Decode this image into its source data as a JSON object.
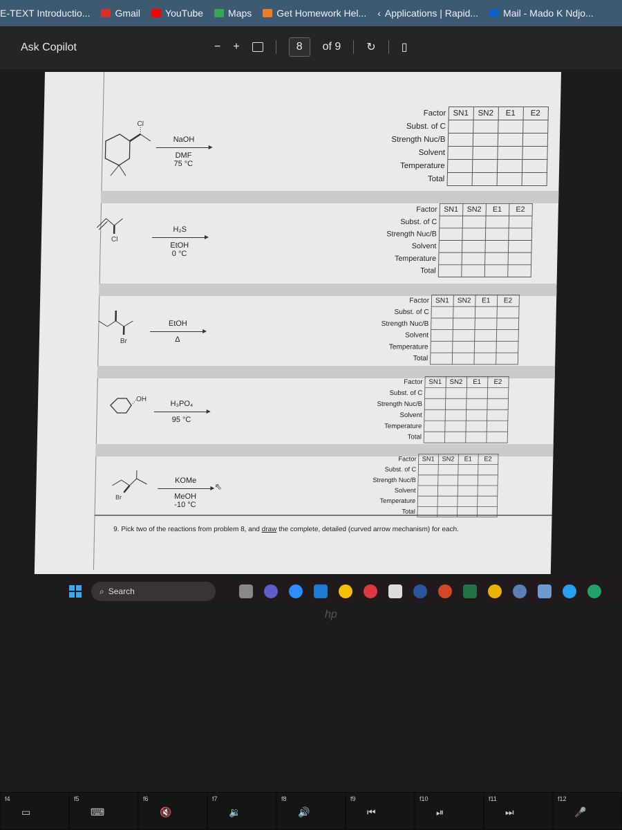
{
  "bookmarks": [
    {
      "label": "E-TEXT Introductio...",
      "color": "#3e5a70"
    },
    {
      "label": "Gmail",
      "color": "#d93025"
    },
    {
      "label": "YouTube",
      "color": "#ff0000"
    },
    {
      "label": "Maps",
      "color": "#34a853"
    },
    {
      "label": "Get Homework Hel...",
      "color": "#f07c25"
    },
    {
      "label": "Applications | Rapid...",
      "color": "#3e5a70"
    },
    {
      "label": "Mail - Mado K Ndjo...",
      "color": "#0a64c8"
    }
  ],
  "pdf_toolbar": {
    "copilot": "Ask Copilot",
    "zoom_out": "−",
    "zoom_in": "+",
    "page": "8",
    "page_total": "of 9"
  },
  "table": {
    "headers": [
      "Factor",
      "SN1",
      "SN2",
      "E1",
      "E2"
    ],
    "rows": [
      "Subst. of C",
      "Strength Nuc/B",
      "Solvent",
      "Temperature",
      "Total"
    ]
  },
  "reactions": [
    {
      "substrate_label": "Cl",
      "reagent": "NaOH",
      "conditions": [
        "DMF",
        "75 °C"
      ]
    },
    {
      "substrate_label": "Cl",
      "reagent": "H₂S",
      "conditions": [
        "EtOH",
        "0 °C"
      ]
    },
    {
      "substrate_label": "Br",
      "reagent": "EtOH",
      "conditions": [
        "Δ"
      ]
    },
    {
      "substrate_label": "OH",
      "reagent": "H₃PO₄",
      "conditions": [
        "95 °C"
      ]
    },
    {
      "substrate_label": "Br",
      "reagent": "KOMe",
      "conditions": [
        "MeOH",
        "-10 °C"
      ]
    }
  ],
  "question": {
    "number": "9.",
    "text_before": "Pick two of the reactions from problem 8, and ",
    "underlined": "draw",
    "text_after": " the complete, detailed (curved arrow mechanism) for each."
  },
  "taskbar": {
    "search": "Search",
    "apps": [
      "file-explorer",
      "teams",
      "zoom",
      "mail",
      "folder",
      "expressvpn",
      "perplexity",
      "word",
      "powerpoint",
      "excel",
      "chrome",
      "r-studio",
      "r",
      "cortana",
      "edge"
    ]
  },
  "keyboard": {
    "keys": [
      "f4",
      "f5",
      "f6",
      "f7",
      "f8",
      "f9",
      "f10",
      "f11",
      "f12"
    ],
    "symbols": [
      "▭",
      "⌨",
      "🔇",
      "🔉",
      "🔊",
      "⏮",
      "⏯",
      "⏭",
      "🎤"
    ]
  },
  "laptop_brand": "hp"
}
